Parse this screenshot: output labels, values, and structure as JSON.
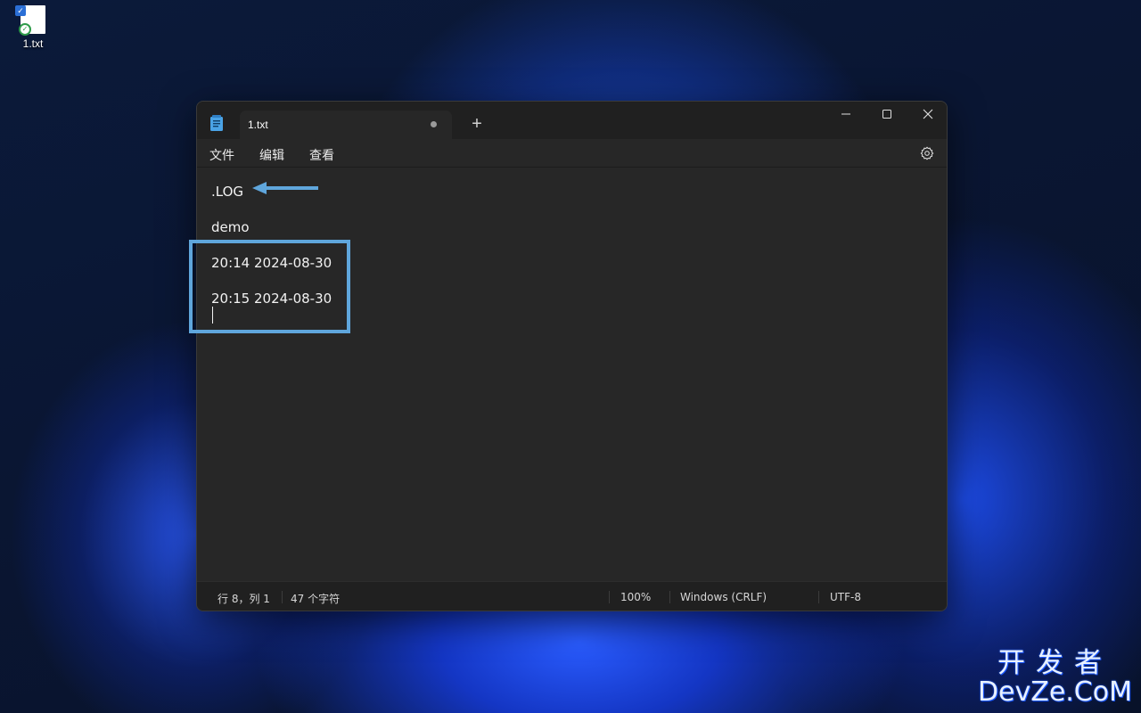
{
  "desktop": {
    "icon_label": "1.txt"
  },
  "window": {
    "tab_title": "1.txt",
    "new_tab_symbol": "+",
    "menu": [
      "文件",
      "编辑",
      "查看"
    ],
    "editor_lines": [
      ".LOG",
      "demo",
      "20:14 2024-08-30",
      "20:15 2024-08-30"
    ],
    "status": {
      "position": "行 8，列 1",
      "char_count": "47 个字符",
      "zoom": "100%",
      "line_ending": "Windows (CRLF)",
      "encoding": "UTF-8"
    }
  },
  "watermark": {
    "cn": "开发者",
    "en": "DevZe.CoM"
  },
  "colors": {
    "annotation": "#5fa6dc",
    "editor_bg": "#272727",
    "titlebar_bg": "#202020"
  },
  "icons": [
    "notepad-icon",
    "tab-modified-dot-icon",
    "minimize-icon",
    "maximize-icon",
    "close-icon",
    "settings-gear-icon",
    "annotation-arrow-icon"
  ]
}
